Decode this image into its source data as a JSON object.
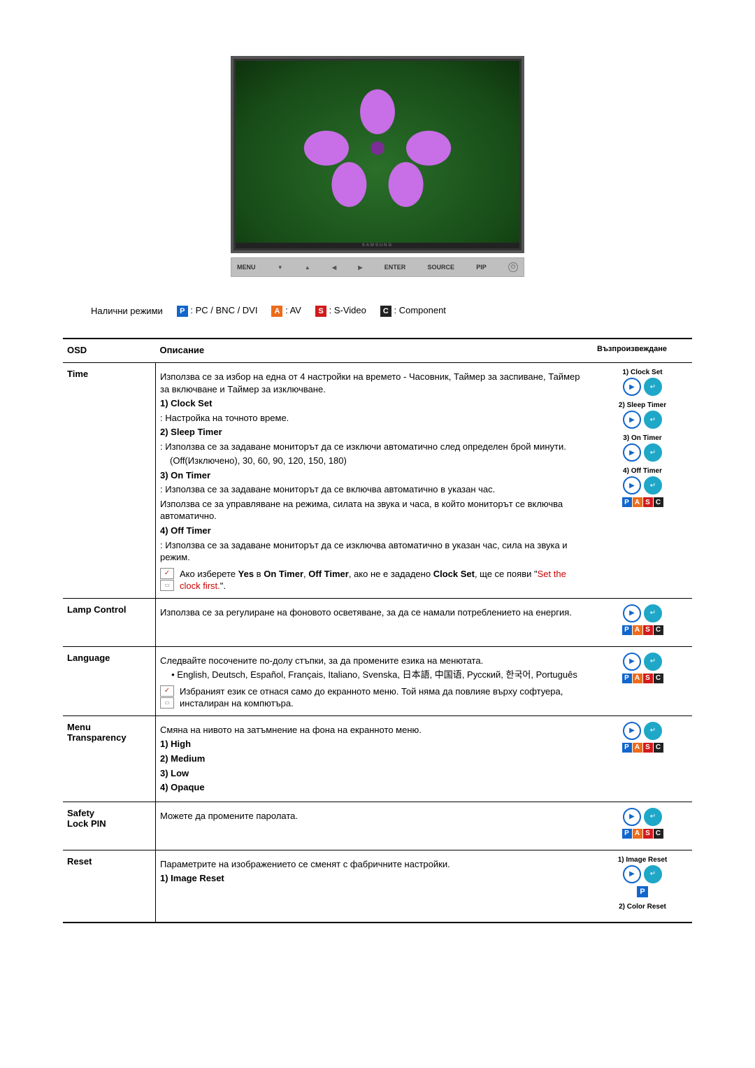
{
  "monitor": {
    "brand": "SAMSUNG",
    "buttons": {
      "menu": "MENU",
      "enter": "ENTER",
      "source": "SOURCE",
      "pip": "PIP"
    }
  },
  "modes": {
    "label": "Налични режими",
    "p": "P",
    "p_text": " : PC / BNC / DVI",
    "a": "A",
    "a_text": " : AV",
    "s": "S",
    "s_text": " : S-Video",
    "c": "C",
    "c_text": " : Component"
  },
  "table": {
    "head_osd": "OSD",
    "head_desc": "Описание",
    "head_play": "Възпроизвеждане"
  },
  "pasc": {
    "p": "P",
    "a": "A",
    "s": "S",
    "c": "C"
  },
  "rows": {
    "time": {
      "name": "Time",
      "intro": "Използва се за избор на една от 4 настройки на времето - Часовник, Таймер за заспиване, Таймер за включване и Таймер за изключване.",
      "item1_title": "1) Clock Set",
      "item1_text": ": Настройка на точното време.",
      "item2_title": "2) Sleep Timer",
      "item2_text": ": Използва се за задаване мониторът да се изключи автоматично след определен брой минути.",
      "item2_opts": "(Off(Изключено), 30, 60, 90, 120, 150, 180)",
      "item3_title": "3) On Timer",
      "item3_text1": ": Използва се за задаване мониторът да се включва автоматично в указан час.",
      "item3_text2": "Използва се за управляване на режима, силата на звука и часа, в който мониторът се включва автоматично.",
      "item4_title": "4) Off Timer",
      "item4_text": ": Използва се за задаване мониторът да се изключва автоматично в указан час, сила на звука и режим.",
      "note_pre": "Ако изберете ",
      "note_yes": "Yes",
      "note_mid1": " в ",
      "note_on": "On Timer",
      "note_comma": ", ",
      "note_off": "Off Timer",
      "note_mid2": ", ако не е зададено ",
      "note_clock": "Clock Set",
      "note_post1": ", ще се появи \"",
      "note_red": "Set the clock first.",
      "note_post2": "\".",
      "play1": "1) Clock Set",
      "play2": "2) Sleep Timer",
      "play3": "3) On Timer",
      "play4": "4) Off Timer"
    },
    "lamp": {
      "name": "Lamp Control",
      "text": "Използва се за регулиране на фоновото осветяване, за да се намали потреблението на енергия."
    },
    "language": {
      "name": "Language",
      "text": "Следвайте посочените по-долу стъпки, за да промените езика на менютата.",
      "list": "• English, Deutsch, Español, Français, Italiano, Svenska, 日本語, 中国语, Русский, 한국어, Português",
      "note": "Избраният език се отнася само до екранното меню. Той няма да повлияе върху софтуера, инсталиран на компютъра."
    },
    "menu_trans": {
      "name1": "Menu",
      "name2": "Transparency",
      "text": "Смяна на нивото на затъмнение на фона на екранното меню.",
      "i1": "1) High",
      "i2": "2) Medium",
      "i3": "3) Low",
      "i4": "4) Opaque"
    },
    "safety": {
      "name1": "Safety",
      "name2": "Lock PIN",
      "text": "Можете да промените паролата."
    },
    "reset": {
      "name": "Reset",
      "text": "Параметрите на изображението се сменят с фабричните настройки.",
      "i1": "1) Image Reset",
      "play1": "1) Image Reset",
      "play2": "2) Color Reset"
    }
  }
}
